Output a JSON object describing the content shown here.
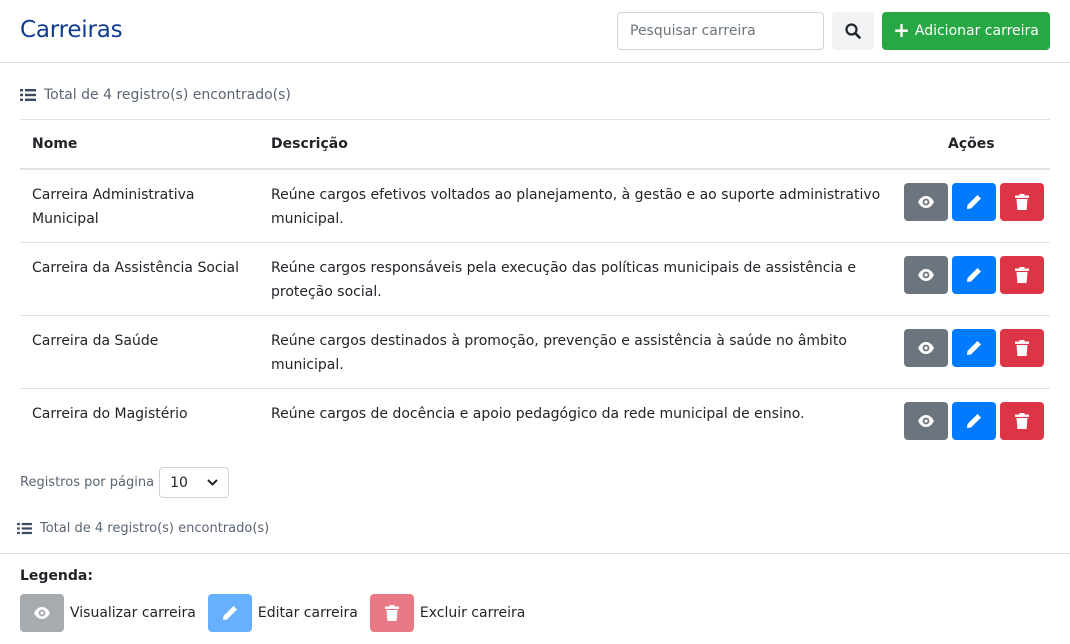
{
  "header": {
    "title": "Carreiras",
    "search_placeholder": "Pesquisar carreira",
    "add_label": "Adicionar carreira"
  },
  "total_text": "Total de 4 registro(s) encontrado(s)",
  "table": {
    "columns": [
      "Nome",
      "Descrição",
      "Ações"
    ],
    "rows": [
      {
        "name": "Carreira Administrativa Municipal",
        "description": "Reúne cargos efetivos voltados ao planejamento, à gestão e ao suporte administrativo municipal."
      },
      {
        "name": "Carreira da Assistência Social",
        "description": "Reúne cargos responsáveis pela execução das políticas municipais de assistência e proteção social."
      },
      {
        "name": "Carreira da Saúde",
        "description": "Reúne cargos destinados à promoção, prevenção e assistência à saúde no âmbito municipal."
      },
      {
        "name": "Carreira do Magistério",
        "description": "Reúne cargos de docência e apoio pedagógico da rede municipal de ensino."
      }
    ]
  },
  "pagination": {
    "label": "Registros por página",
    "value": "10"
  },
  "legend": {
    "title": "Legenda:",
    "items": [
      {
        "label": "Visualizar carreira",
        "icon": "eye-icon"
      },
      {
        "label": "Editar carreira",
        "icon": "pencil-icon"
      },
      {
        "label": "Excluir carreira",
        "icon": "trash-icon"
      }
    ]
  },
  "colors": {
    "title": "#0d3b8e",
    "add": "#28a745",
    "view": "#6c757d",
    "edit": "#007bff",
    "delete": "#dc3545"
  }
}
